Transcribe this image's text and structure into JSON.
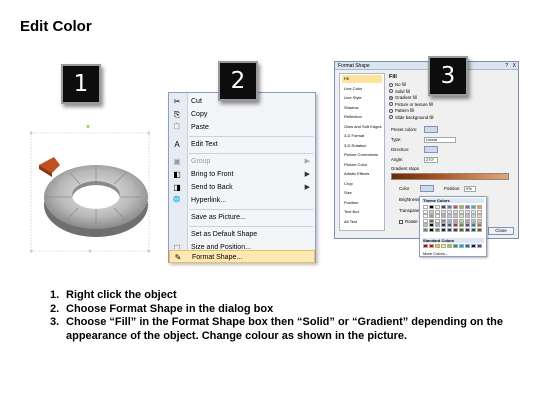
{
  "title": "Edit Color",
  "steps": {
    "one": "1",
    "two": "2",
    "three": "3"
  },
  "context_menu": {
    "items": [
      {
        "label": "Cut",
        "icon": "cut-icon",
        "glyph": "✂",
        "disabled": false,
        "submenu": false
      },
      {
        "label": "Copy",
        "icon": "copy-icon",
        "glyph": "⎘",
        "disabled": false,
        "submenu": false
      },
      {
        "label": "Paste",
        "icon": "paste-icon",
        "glyph": "📋",
        "disabled": false,
        "submenu": false
      },
      {
        "label": "Edit Text",
        "icon": "edit-text-icon",
        "glyph": "A",
        "disabled": false,
        "submenu": false
      },
      {
        "label": "Group",
        "icon": "group-icon",
        "glyph": "▣",
        "disabled": true,
        "submenu": true
      },
      {
        "label": "Bring to Front",
        "icon": "bring-to-front-icon",
        "glyph": "◧",
        "disabled": false,
        "submenu": true
      },
      {
        "label": "Send to Back",
        "icon": "send-to-back-icon",
        "glyph": "◨",
        "disabled": false,
        "submenu": true
      },
      {
        "label": "Hyperlink...",
        "icon": "hyperlink-icon",
        "glyph": "🌐",
        "disabled": false,
        "submenu": false
      },
      {
        "label": "Save as Picture...",
        "icon": "",
        "glyph": "",
        "disabled": false,
        "submenu": false
      },
      {
        "label": "Set as Default Shape",
        "icon": "",
        "glyph": "",
        "disabled": false,
        "submenu": false
      },
      {
        "label": "Size and Position...",
        "icon": "size-position-icon",
        "glyph": "⬚",
        "disabled": false,
        "submenu": false
      },
      {
        "label": "Format Shape...",
        "icon": "format-shape-icon",
        "glyph": "✎",
        "disabled": false,
        "submenu": false,
        "highlighted": true
      }
    ],
    "submenu_arrow": "▶"
  },
  "format_dialog": {
    "title": "Format Shape",
    "help": "?",
    "close_x": "X",
    "nav": [
      "Fill",
      "Line Color",
      "Line Style",
      "Shadow",
      "Reflection",
      "Glow and Soft Edges",
      "3-D Format",
      "3-D Rotation",
      "Picture Corrections",
      "Picture Color",
      "Artistic Effects",
      "Crop",
      "Size",
      "Position",
      "Text Box",
      "Alt Text"
    ],
    "selected_nav": "Fill",
    "fill_heading": "Fill",
    "options": [
      "No fill",
      "Solid fill",
      "Gradient fill",
      "Picture or texture fill",
      "Pattern fill"
    ],
    "selected_option": "Gradient fill",
    "slide_background": "Slide background fill",
    "preset_label": "Preset colors:",
    "type_label": "Type:",
    "type_value": "Linear",
    "direction_label": "Direction:",
    "angle_label": "Angle:",
    "angle_value": "270°",
    "gradient_stops_label": "Gradient stops",
    "color_label": "Color",
    "position_label": "Position:",
    "position_value": "0%",
    "brightness_label": "Brightness:",
    "transparency_label": "Transparency:",
    "rotate_label": "Rotate with shape",
    "close_button": "Close"
  },
  "color_palette": {
    "theme_label": "Theme Colors",
    "standard_label": "Standard Colors",
    "more_label": "More Colors...",
    "theme_top": [
      "#ffffff",
      "#000000",
      "#eeece1",
      "#1f497d",
      "#4f81bd",
      "#c0504d",
      "#9bbb59",
      "#8064a2",
      "#4bacc6",
      "#f79646"
    ],
    "standard": [
      "#c00000",
      "#ff0000",
      "#ffc000",
      "#ffff00",
      "#92d050",
      "#00b050",
      "#00b0f0",
      "#0070c0",
      "#002060",
      "#7030a0"
    ]
  },
  "instructions": [
    {
      "num": "1.",
      "text": "Right click the object"
    },
    {
      "num": "2.",
      "text": "Choose Format Shape in the dialog box"
    },
    {
      "num": "3.",
      "text": "Choose “Fill” in the Format Shape box then “Solid” or “Gradient” depending on the appearance of the object. Change colour as shown in the picture."
    }
  ],
  "colors": {
    "accent_orange": "#c0501e",
    "ring_gray": "#8c8c8c",
    "highlight": "#fce8b0"
  }
}
